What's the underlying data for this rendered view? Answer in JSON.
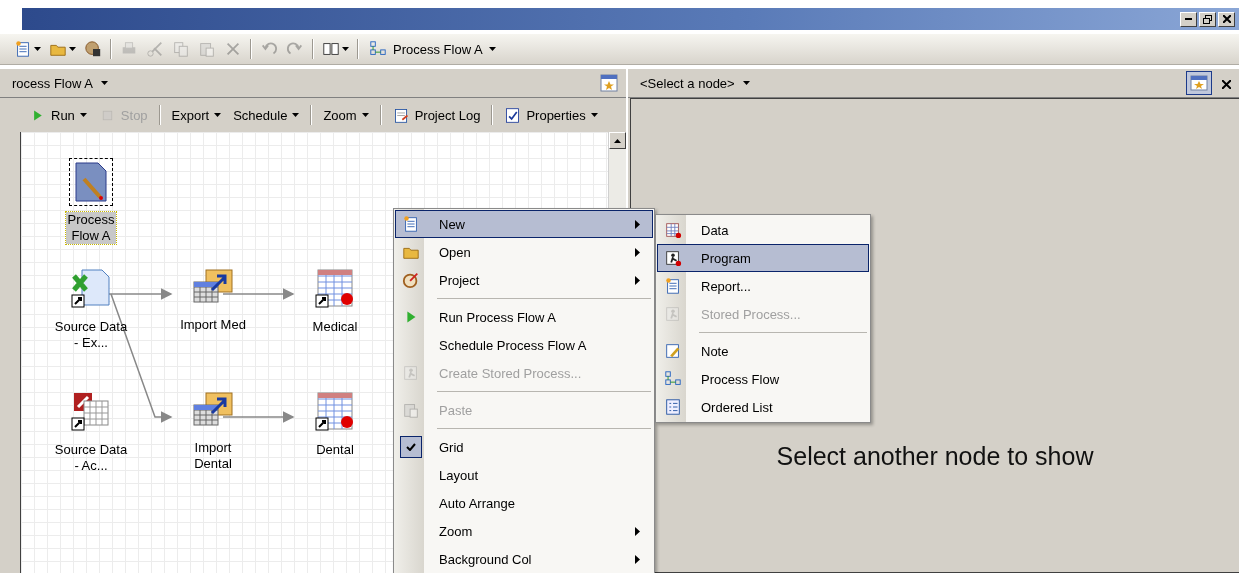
{
  "toolbar": {
    "buttons": [
      {
        "kind": "new",
        "disabled": false,
        "dropdown": true
      },
      {
        "kind": "open",
        "disabled": false,
        "dropdown": true
      },
      {
        "kind": "save",
        "disabled": false,
        "dropdown": false
      },
      {
        "kind": "sep"
      },
      {
        "kind": "print",
        "disabled": true,
        "dropdown": false
      },
      {
        "kind": "cut",
        "disabled": true,
        "dropdown": false
      },
      {
        "kind": "copy",
        "disabled": true,
        "dropdown": false
      },
      {
        "kind": "paste",
        "disabled": true,
        "dropdown": false
      },
      {
        "kind": "delete",
        "disabled": true,
        "dropdown": false
      },
      {
        "kind": "sep"
      },
      {
        "kind": "undo",
        "disabled": true,
        "dropdown": false
      },
      {
        "kind": "redo",
        "disabled": true,
        "dropdown": false
      },
      {
        "kind": "sep"
      },
      {
        "kind": "layout",
        "disabled": false,
        "dropdown": true
      },
      {
        "kind": "sep"
      }
    ],
    "flow_selector": "Process Flow A"
  },
  "flow_pane": {
    "title": "rocess Flow A",
    "toolbar": [
      {
        "kind": "run",
        "label": "Run",
        "disabled": false,
        "dropdown": true
      },
      {
        "kind": "stop",
        "label": "Stop",
        "disabled": true,
        "dropdown": false
      },
      {
        "kind": "sep"
      },
      {
        "kind": "text",
        "label": "Export",
        "disabled": false,
        "dropdown": true
      },
      {
        "kind": "text",
        "label": "Schedule",
        "disabled": false,
        "dropdown": true
      },
      {
        "kind": "sep"
      },
      {
        "kind": "text",
        "label": "Zoom",
        "disabled": false,
        "dropdown": true
      },
      {
        "kind": "sep"
      },
      {
        "kind": "log",
        "label": "Project Log",
        "disabled": false,
        "dropdown": false
      },
      {
        "kind": "sep"
      },
      {
        "kind": "properties",
        "label": "Properties",
        "disabled": false,
        "dropdown": true
      }
    ],
    "nodes": [
      {
        "kind": "flow",
        "label": "Process Flow A",
        "selected": true
      },
      {
        "kind": "excel",
        "label": "Source Data - Ex...",
        "selected": false
      },
      {
        "kind": "import",
        "label": "Import Med",
        "selected": false
      },
      {
        "kind": "table",
        "label": "Medical",
        "selected": false
      },
      {
        "kind": "access",
        "label": "Source Data - Ac...",
        "selected": false
      },
      {
        "kind": "import",
        "label": "Import Dental",
        "selected": false
      },
      {
        "kind": "table",
        "label": "Dental",
        "selected": false
      }
    ]
  },
  "context_menu": {
    "items": [
      {
        "kind": "new",
        "label": "New",
        "submenu": true,
        "disabled": false,
        "checked": false,
        "selected": true
      },
      {
        "kind": "open",
        "label": "Open",
        "submenu": true,
        "disabled": false,
        "checked": false,
        "selected": false
      },
      {
        "kind": "project",
        "label": "Project",
        "submenu": true,
        "disabled": false,
        "checked": false,
        "selected": false
      },
      {
        "kind": "separator"
      },
      {
        "kind": "run",
        "label": "Run Process Flow A",
        "submenu": false,
        "disabled": false,
        "checked": false,
        "selected": false
      },
      {
        "kind": "plain",
        "label": "Schedule Process Flow A",
        "submenu": false,
        "disabled": false,
        "checked": false,
        "selected": false
      },
      {
        "kind": "stored",
        "label": "Create Stored Process...",
        "submenu": false,
        "disabled": true,
        "checked": false,
        "selected": false
      },
      {
        "kind": "separator"
      },
      {
        "kind": "paste",
        "label": "Paste",
        "submenu": false,
        "disabled": true,
        "checked": false,
        "selected": false
      },
      {
        "kind": "separator"
      },
      {
        "kind": "plain",
        "label": "Grid",
        "submenu": false,
        "disabled": false,
        "checked": true,
        "selected": false
      },
      {
        "kind": "plain",
        "label": "Layout",
        "submenu": false,
        "disabled": false,
        "checked": false,
        "selected": false
      },
      {
        "kind": "plain",
        "label": "Auto Arrange",
        "submenu": false,
        "disabled": false,
        "checked": false,
        "selected": false
      },
      {
        "kind": "plain",
        "label": "Zoom",
        "submenu": true,
        "disabled": false,
        "checked": false,
        "selected": false
      },
      {
        "kind": "plain",
        "label": "Background Col",
        "submenu": true,
        "disabled": false,
        "checked": false,
        "selected": false
      }
    ]
  },
  "submenu": {
    "items": [
      {
        "kind": "data",
        "label": "Data",
        "disabled": false,
        "selected": false
      },
      {
        "kind": "program",
        "label": "Program",
        "disabled": false,
        "selected": true
      },
      {
        "kind": "report",
        "label": "Report...",
        "disabled": false,
        "selected": false
      },
      {
        "kind": "stored",
        "label": "Stored Process...",
        "disabled": true,
        "selected": false
      },
      {
        "kind": "separator"
      },
      {
        "kind": "note",
        "label": "Note",
        "disabled": false,
        "selected": false
      },
      {
        "kind": "flow",
        "label": "Process Flow",
        "disabled": false,
        "selected": false
      },
      {
        "kind": "list",
        "label": "Ordered List",
        "disabled": false,
        "selected": false
      }
    ]
  },
  "details_pane": {
    "selector": "<Select a node>",
    "message": "Select another node to show"
  }
}
